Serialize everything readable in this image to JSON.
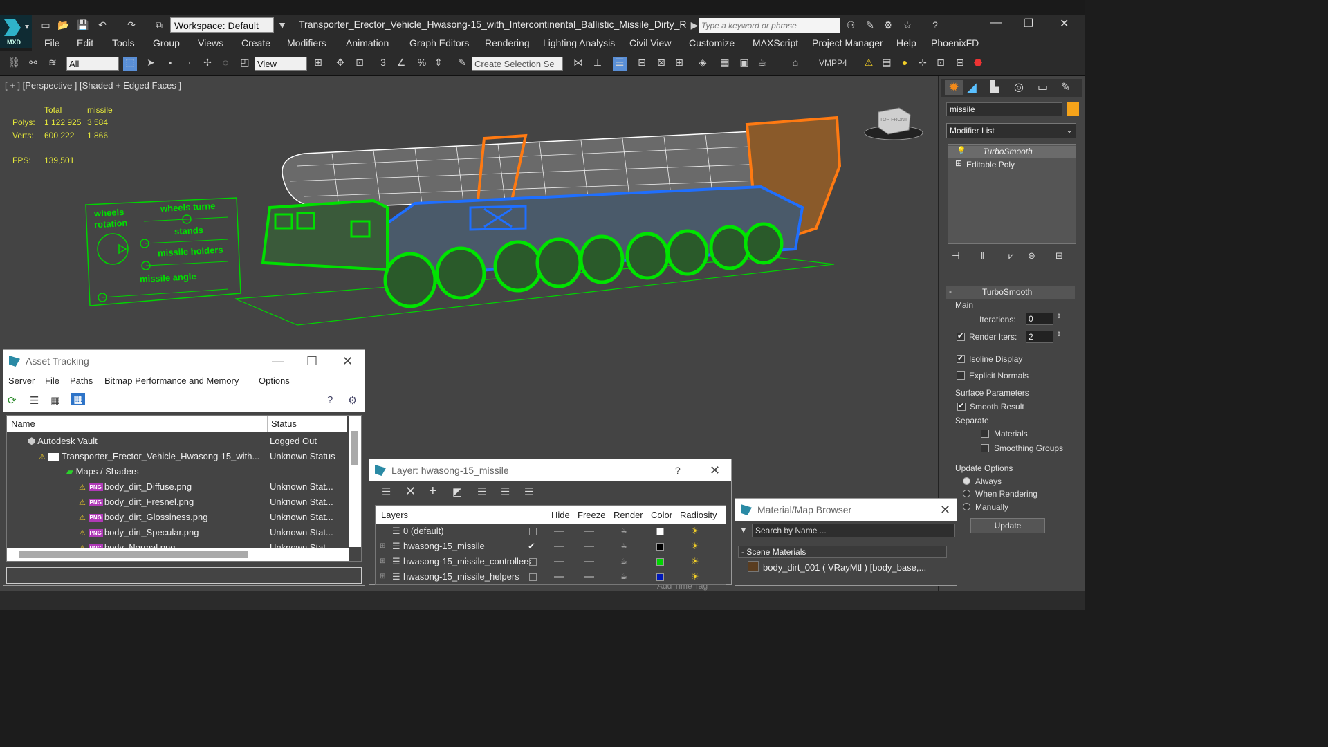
{
  "app": {
    "workspace": "Workspace: Default",
    "window_title": "Transporter_Erector_Vehicle_Hwasong-15_with_Intercontinental_Ballistic_Missile_Dirty_Rigg...",
    "search_placeholder": "Type a keyword or phrase",
    "logo_label": "MXD"
  },
  "menu": [
    "File",
    "Edit",
    "Tools",
    "Group",
    "Views",
    "Create",
    "Modifiers",
    "Animation",
    "Graph Editors",
    "Rendering",
    "Lighting Analysis",
    "Civil View",
    "Customize",
    "MAXScript",
    "Project Manager",
    "Help",
    "PhoenixFD"
  ],
  "toolbar": {
    "filter": "All",
    "reference": "View",
    "selection_set": "Create Selection Se",
    "vmpp": "VMPP4"
  },
  "viewport": {
    "label": "[ + ] [Perspective ] [Shaded + Edged Faces ]",
    "stats": {
      "col_total": "Total",
      "col_missile": "missile",
      "polys_label": "Polys:",
      "polys_total": "1 122 925",
      "polys_missile": "3 584",
      "verts_label": "Verts:",
      "verts_total": "600 222",
      "verts_missile": "1 866",
      "fps_label": "FPS:",
      "fps_value": "139,501"
    },
    "rig_labels": {
      "wheels_rotation_1": "wheels",
      "wheels_rotation_2": "rotation",
      "wheels_turn": "wheels turne",
      "stands": "stands",
      "missile_holders": "missile holders",
      "missile_angle": "missile angle"
    },
    "viewcube_label": "TOP FRONT"
  },
  "command_panel": {
    "object_name": "missile",
    "object_color": "#f5a31a",
    "modifier_list": "Modifier List",
    "stack": [
      "TurboSmooth",
      "Editable Poly"
    ],
    "rollout_title": "TurboSmooth",
    "main": "Main",
    "iterations_label": "Iterations:",
    "iterations": "0",
    "render_iters_label": "Render Iters:",
    "render_iters": "2",
    "isoline_display": "Isoline Display",
    "explicit_normals": "Explicit Normals",
    "surface_parameters": "Surface Parameters",
    "smooth_result": "Smooth Result",
    "separate": "Separate",
    "materials": "Materials",
    "smoothing_groups": "Smoothing Groups",
    "update_options": "Update Options",
    "always": "Always",
    "when_rendering": "When Rendering",
    "manually": "Manually",
    "update_button": "Update"
  },
  "asset_tracking": {
    "title": "Asset Tracking",
    "menu": [
      "Server",
      "File",
      "Paths",
      "Bitmap Performance and Memory",
      "Options"
    ],
    "col_name": "Name",
    "col_status": "Status",
    "rows": [
      {
        "name": "Autodesk Vault",
        "status": "Logged Out"
      },
      {
        "name": "Transporter_Erector_Vehicle_Hwasong-15_with...",
        "status": "Unknown Status"
      },
      {
        "name": "Maps / Shaders",
        "status": ""
      },
      {
        "name": "body_dirt_Diffuse.png",
        "status": "Unknown Stat..."
      },
      {
        "name": "body_dirt_Fresnel.png",
        "status": "Unknown Stat..."
      },
      {
        "name": "body_dirt_Glossiness.png",
        "status": "Unknown Stat..."
      },
      {
        "name": "body_dirt_Specular.png",
        "status": "Unknown Stat..."
      },
      {
        "name": "body_Normal.png",
        "status": "Unknown Stat..."
      }
    ],
    "png_badge": "PNG"
  },
  "layer_dialog": {
    "title": "Layer: hwasong-15_missile",
    "help": "?",
    "headers": [
      "Layers",
      "Hide",
      "Freeze",
      "Render",
      "Color",
      "Radiosity"
    ],
    "layers": [
      {
        "name": "0 (default)",
        "color": "#ffffff"
      },
      {
        "name": "hwasong-15_missile",
        "color": "#000000"
      },
      {
        "name": "hwasong-15_missile_controllers",
        "color": "#00d400"
      },
      {
        "name": "hwasong-15_missile_helpers",
        "color": "#0018b8"
      }
    ]
  },
  "material_browser": {
    "title": "Material/Map Browser",
    "search": "Search by Name ...",
    "group": "- Scene Materials",
    "item": "body_dirt_001 ( VRayMtl ) [body_base,..."
  },
  "statusbar": {
    "add_time_tag": "Add Time Tag"
  }
}
